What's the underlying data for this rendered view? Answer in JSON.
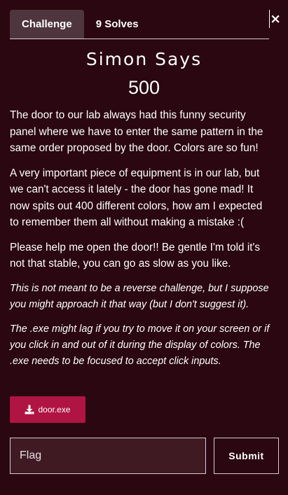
{
  "modal": {
    "close_label": "×",
    "tabs": [
      {
        "label": "Challenge",
        "active": true
      },
      {
        "label": "9 Solves",
        "active": false
      }
    ]
  },
  "challenge": {
    "name": "Simon Says",
    "points": "500",
    "paragraphs": [
      "The door to our lab always had this funny security panel where we have to enter the same pattern in the same order proposed by the door. Colors are so fun!",
      "A very important piece of equipment is in our lab, but we can't access it lately - the door has gone mad! It now spits out 400 different colors, how am I expected to remember them all without making a mistake :(",
      "Please help me open the door!! Be gentle I'm told it's not that stable, you can go as slow as you like."
    ],
    "notes": [
      "This is not meant to be a reverse challenge, but I suppose you might approach it that way (but I don't suggest it).",
      "The .exe might lag if you try to move it on your screen or if you click in and out of it during the display of colors. The .exe needs to be focused to accept click inputs."
    ],
    "file": {
      "label": "door.exe",
      "icon": "download-icon"
    }
  },
  "form": {
    "flag_placeholder": "Flag",
    "flag_value": "",
    "submit_label": "Submit"
  },
  "colors": {
    "background": "#2a0711",
    "tab_active": "#4f363e",
    "download_button": "#b01442",
    "input_background": "#401a23"
  }
}
